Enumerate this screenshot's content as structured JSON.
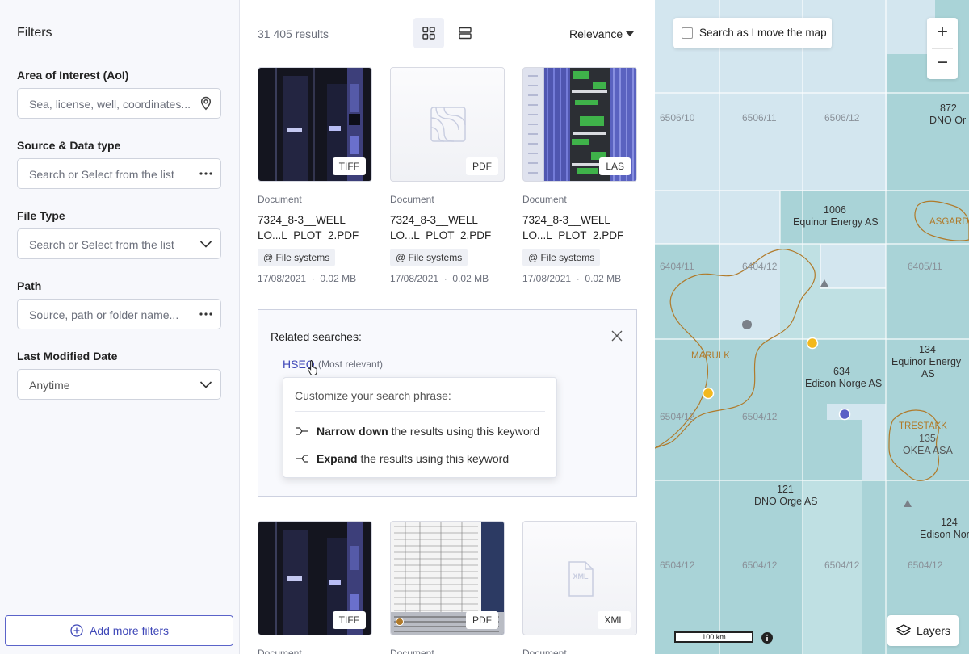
{
  "sidebar": {
    "title": "Filters",
    "aoi_label": "Area of Interest (AoI)",
    "aoi_placeholder": "Sea, license, well, coordinates...",
    "source_label": "Source & Data type",
    "source_placeholder": "Search or Select from the list",
    "filetype_label": "File Type",
    "filetype_placeholder": "Search or Select from the list",
    "path_label": "Path",
    "path_placeholder": "Source, path or folder name...",
    "date_label": "Last Modified Date",
    "date_value": "Anytime",
    "add_filters": "Add more filters"
  },
  "results": {
    "count": "31 405 results",
    "sort": "Relevance",
    "cards": [
      {
        "type": "TIFF",
        "kind": "Document",
        "name": "7324_8-3__WELL LO...L_PLOT_2.PDF",
        "source": "@ File systems",
        "date": "17/08/2021",
        "size": "0.02 MB"
      },
      {
        "type": "PDF",
        "kind": "Document",
        "name": "7324_8-3__WELL LO...L_PLOT_2.PDF",
        "source": "@ File systems",
        "date": "17/08/2021",
        "size": "0.02 MB"
      },
      {
        "type": "LAS",
        "kind": "Document",
        "name": "7324_8-3__WELL LO...L_PLOT_2.PDF",
        "source": "@ File systems",
        "date": "17/08/2021",
        "size": "0.02 MB"
      },
      {
        "type": "TIFF",
        "kind": "Document"
      },
      {
        "type": "PDF",
        "kind": "Document"
      },
      {
        "type": "XML",
        "kind": "Document"
      }
    ],
    "related": {
      "title": "Related searches:",
      "keyword": "HSEQ",
      "note": "(Most relevant)",
      "popup_title": "Customize your search phrase:",
      "narrow_bold": "Narrow down",
      "narrow_rest": "the results using this keyword",
      "expand_bold": "Expand",
      "expand_rest": "the results using this keyword"
    }
  },
  "map": {
    "search_move": "Search as I move the map",
    "zoom_in": "+",
    "zoom_out": "−",
    "scale": "100 km",
    "layers": "Layers",
    "labels": {
      "b6506_10": "6506/10",
      "b6506_11": "6506/11",
      "b6506_12": "6506/12",
      "b6404_11": "6404/11",
      "b6404_12": "6404/12",
      "b6405_11": "6405/11",
      "b6504_12a": "6504/12",
      "b6504_12b": "6504/12",
      "b6504_12c": "6504/12",
      "b6504_12d": "6504/12",
      "b6504_12e": "6504/12",
      "b6504_12f": "6504/12",
      "l872": "872",
      "l872n": "DNO Or",
      "l1006": "1006",
      "l1006n": "Equinor Energy AS",
      "l634": "634",
      "l634n": "Edison Norge AS",
      "l134": "134",
      "l134n1": "Equinor Energy",
      "l134n2": "AS",
      "l121": "121",
      "l121n": "DNO Orge AS",
      "l135": "135",
      "l135n": "OKEA ASA",
      "l124": "124",
      "l124n": "Edison Norge",
      "asgard": "ASGARD",
      "marulk": "MARULK",
      "trestakk": "TRESTAKK"
    }
  }
}
